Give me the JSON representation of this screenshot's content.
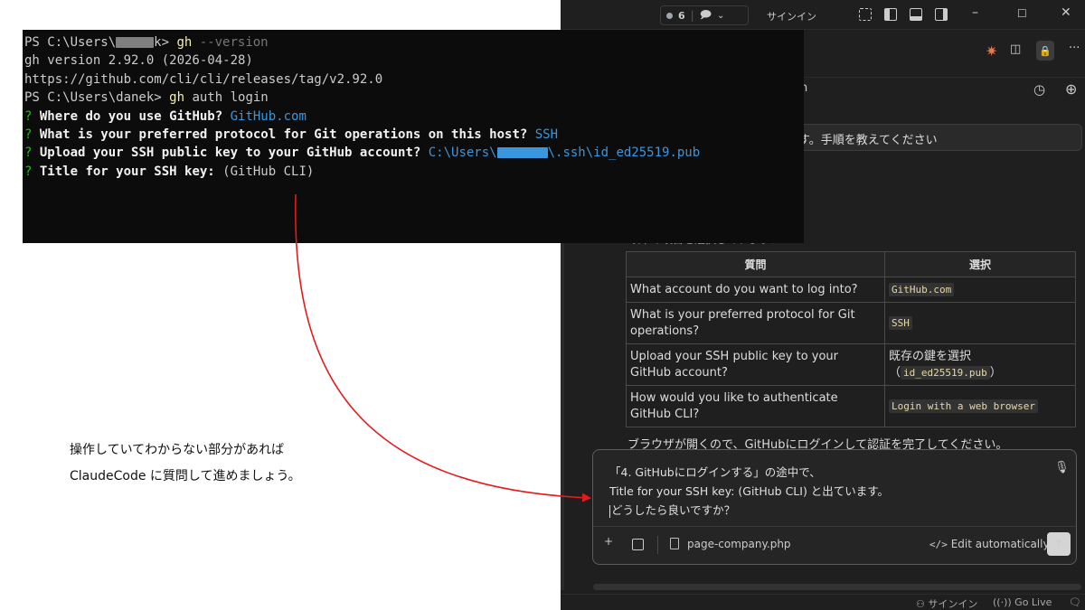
{
  "terminal": {
    "lines": [
      {
        "prompt": "PS C:\\Users\\",
        "redacted": "danek",
        "prompt_tail": "k> ",
        "cmd": "gh",
        "args": " --version"
      },
      {
        "text": "gh version 2.92.0 (2026-04-28)"
      },
      {
        "text": "https://github.com/cli/cli/releases/tag/v2.92.0"
      },
      {
        "prompt": "PS C:\\Users\\danek> ",
        "cmd": "gh",
        "args_plain": " auth login"
      }
    ],
    "questions": [
      {
        "mark": "?",
        "q": " Where do you use GitHub? ",
        "a": "GitHub.com"
      },
      {
        "mark": "?",
        "q": " What is your preferred protocol for Git operations on this host? ",
        "a": "SSH"
      },
      {
        "mark": "?",
        "q": " Upload your SSH public key to your GitHub account? ",
        "a_pre": "C:\\Users\\",
        "a_post": "\\.ssh\\id_ed25519.pub"
      },
      {
        "mark": "?",
        "q": " Title for your SSH key: ",
        "default": "(GitHub CLI)"
      }
    ]
  },
  "vscode": {
    "titlebar": {
      "badge_count": "6",
      "signin": "サインイン"
    },
    "session_title_fragment": "n",
    "user_message": "す。手順を教えてください",
    "table": {
      "headers": [
        "質問",
        "選択"
      ],
      "rows": [
        {
          "q": "What account do you want to log into?",
          "a_code": "GitHub.com"
        },
        {
          "q": "What is your preferred protocol for Git operations?",
          "a_code": "SSH"
        },
        {
          "q": "Upload your SSH public key to your GitHub account?",
          "a_text": "既存の鍵を選択",
          "a_code_paren": "id_ed25519.pub"
        },
        {
          "q": "How would you like to authenticate GitHub CLI?",
          "a_code": "Login with a web browser"
        }
      ]
    },
    "info_line": "ブラウザが開くので、GitHubにログインして認証を完了してください。",
    "input": {
      "lines": [
        "「4. GitHubにログインする」の途中で、",
        "Title for your SSH key: (GitHub CLI) と出ています。",
        "どうしたら良いですか？"
      ],
      "file_name": "page-company.php",
      "edit_mode": "Edit automatically"
    },
    "statusbar": {
      "signin": "サインイン",
      "golive": "Go Live"
    }
  },
  "annotation": {
    "lines": [
      "操作していてわからない部分があれば",
      "ClaudeCode に質問して進めましょう。"
    ]
  },
  "colors": {
    "arrow": "#e41b1b",
    "terminal_bg": "#0c0c0c",
    "editor_bg": "#1f1f1f"
  }
}
